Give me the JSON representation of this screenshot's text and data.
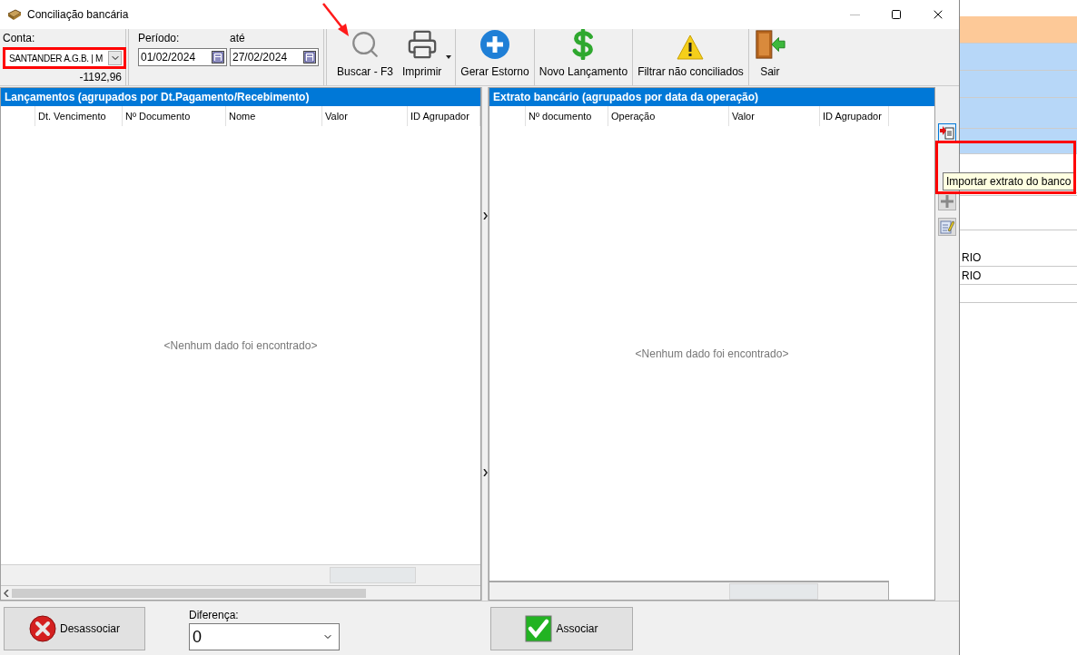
{
  "window": {
    "title": "Conciliação bancária"
  },
  "account": {
    "label": "Conta:",
    "value": "SANTANDER A.G.B. | M",
    "balance": "-1192,96",
    "highlighted": true
  },
  "period": {
    "label": "Período:",
    "from": "01/02/2024",
    "to_label": "até",
    "to": "27/02/2024"
  },
  "toolbar": [
    {
      "kind": "search",
      "label": "Buscar - F3",
      "dropdown": false,
      "pointed": true
    },
    {
      "kind": "printer",
      "label": "Imprimir",
      "dropdown": true,
      "pointed": false
    },
    {
      "kind": "add",
      "label": "Gerar Estorno",
      "dropdown": false,
      "pointed": false
    },
    {
      "kind": "money",
      "label": "Novo Lançamento",
      "dropdown": false,
      "pointed": false
    },
    {
      "kind": "warning",
      "label": "Filtrar não conciliados",
      "dropdown": false,
      "pointed": false
    },
    {
      "kind": "exit",
      "label": "Sair",
      "dropdown": false,
      "pointed": false
    }
  ],
  "left_panel": {
    "title": "Lançamentos (agrupados por Dt.Pagamento/Recebimento)",
    "columns": [
      "Dt. Vencimento",
      "Nº Documento",
      "Nome",
      "Valor",
      "ID Agrupador"
    ],
    "empty_text": "<Nenhum dado foi encontrado>"
  },
  "right_panel": {
    "title": "Extrato bancário (agrupados por data da operação)",
    "columns": [
      "Nº documento",
      "Operação",
      "Valor",
      "ID  Agrupador"
    ],
    "empty_text": "<Nenhum dado foi encontrado>"
  },
  "side_tools": [
    {
      "kind": "import",
      "selected": true
    },
    {
      "kind": "add",
      "selected": false
    },
    {
      "kind": "edit",
      "selected": false
    }
  ],
  "tooltip": {
    "text": "Importar extrato do banco",
    "highlighted": true
  },
  "bottom": {
    "unassociate": "Desassociar",
    "difference_label": "Diferença:",
    "difference_value": "0",
    "associate": "Associar"
  },
  "background_app": {
    "rows": [
      "RIO",
      "RIO"
    ]
  }
}
